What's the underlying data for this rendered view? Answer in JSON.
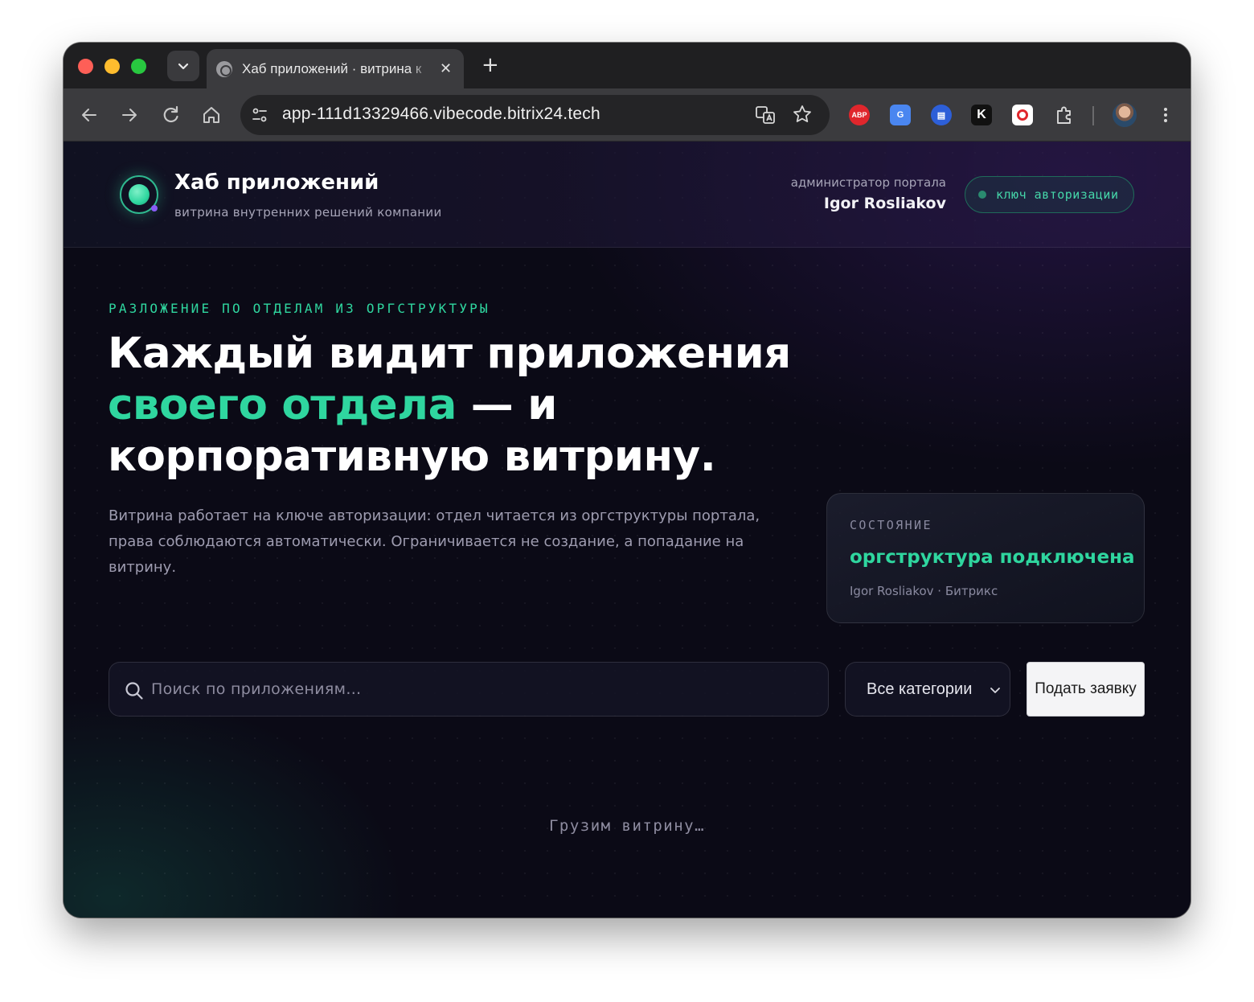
{
  "browser": {
    "tab_title": "Хаб приложений · витрина к",
    "url": "app-111d13329466.vibecode.bitrix24.tech",
    "extensions": {
      "abp_label": "ABP",
      "translate_label": "G",
      "doc_label": "▤",
      "k_label": "K"
    }
  },
  "header": {
    "brand_title": "Хаб приложений",
    "brand_subtitle": "витрина внутренних решений компании",
    "admin_role": "администратор портала",
    "admin_name": "Igor Rosliakov",
    "auth_pill": "ключ авторизации"
  },
  "hero": {
    "eyebrow": "РАЗЛОЖЕНИЕ ПО ОТДЕЛАМ ИЗ ОРГСТРУКТУРЫ",
    "title_part1": "Каждый видит приложения",
    "title_accent": "своего отдела",
    "title_part2": " — и корпоративную витрину.",
    "description": "Витрина работает на ключе авторизации: отдел читается из оргструктуры портала, права соблюдаются автоматически. Ограничивается не создание, а попадание на витрину."
  },
  "status": {
    "label": "СОСТОЯНИЕ",
    "value": "оргструктура подключена",
    "meta": "Igor Rosliakov · Битрикс"
  },
  "filters": {
    "search_placeholder": "Поиск по приложениям…",
    "category_selected": "Все категории",
    "apply_label": "Подать заявку"
  },
  "loading_text": "Грузим витрину…",
  "colors": {
    "accent": "#2fd69f",
    "background": "#0b0a16",
    "text_muted": "#9e9cb0"
  }
}
